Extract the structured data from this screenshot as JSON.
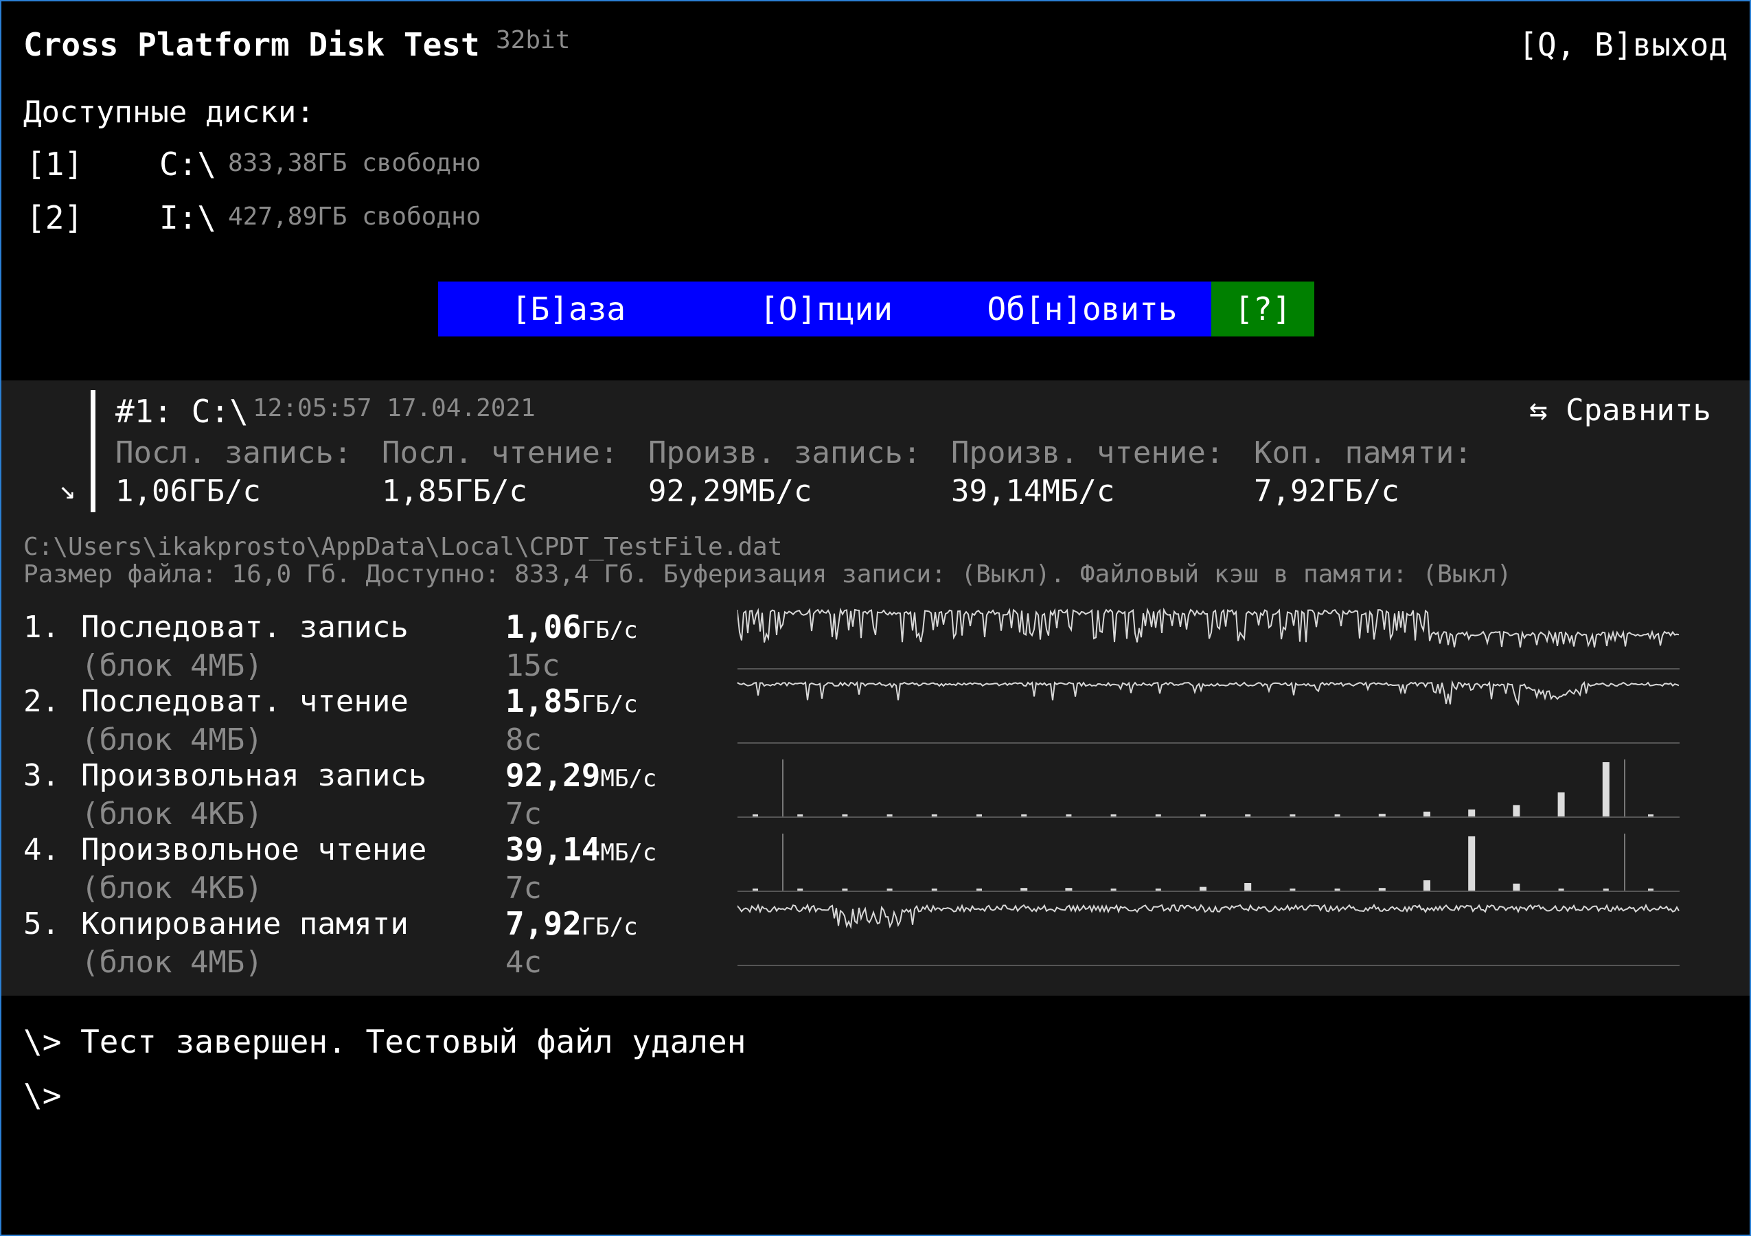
{
  "header": {
    "title": "Cross Platform Disk Test",
    "bits": "32bit",
    "exit": "[Q, B]выход"
  },
  "disks": {
    "label": "Доступные диски:",
    "items": [
      {
        "key": "[1]",
        "path": "C:\\",
        "free": "833,38ГБ свободно"
      },
      {
        "key": "[2]",
        "path": "I:\\",
        "free": "427,89ГБ свободно"
      }
    ]
  },
  "menu": {
    "base": "[Б]аза",
    "options": "[О]пции",
    "refresh": "Об[н]овить",
    "help": "[?]"
  },
  "summary": {
    "arrow": "↘",
    "title": "#1: C:\\",
    "datetime": "12:05:57 17.04.2021",
    "compare": "⇆ Сравнить",
    "cols": [
      {
        "label": "Посл. запись:",
        "value": "1,06ГБ/с"
      },
      {
        "label": "Посл. чтение:",
        "value": "1,85ГБ/с"
      },
      {
        "label": "Произв. запись:",
        "value": "92,29МБ/с"
      },
      {
        "label": "Произв. чтение:",
        "value": "39,14МБ/с"
      },
      {
        "label": "Коп. памяти:",
        "value": "7,92ГБ/с"
      }
    ]
  },
  "file": {
    "path": "C:\\Users\\ikakprosto\\AppData\\Local\\CPDT_TestFile.dat",
    "info": "Размер файла: 16,0 Гб. Доступно: 833,4 Гб. Буферизация записи: (Выкл). Файловый кэш в памяти: (Выкл)"
  },
  "tests": [
    {
      "idx": "1.",
      "name": "Последоват. запись",
      "block": "(блок 4МБ)",
      "value": "1,06",
      "unit": "ГБ/с",
      "time": "15с"
    },
    {
      "idx": "2.",
      "name": "Последоват. чтение",
      "block": "(блок 4МБ)",
      "value": "1,85",
      "unit": "ГБ/с",
      "time": "8с"
    },
    {
      "idx": "3.",
      "name": "Произвольная запись",
      "block": "(блок 4КБ)",
      "value": "92,29",
      "unit": "МБ/с",
      "time": "7с"
    },
    {
      "idx": "4.",
      "name": "Произвольное чтение",
      "block": "(блок 4КБ)",
      "value": "39,14",
      "unit": "МБ/с",
      "time": "7с"
    },
    {
      "idx": "5.",
      "name": "Копирование памяти",
      "block": "(блок 4МБ)",
      "value": "7,92",
      "unit": "ГБ/с",
      "time": "4с"
    }
  ],
  "histograms": {
    "random_write": [
      0.02,
      0.02,
      0.02,
      0.02,
      0.02,
      0.02,
      0.02,
      0.02,
      0.02,
      0.02,
      0.02,
      0.03,
      0.03,
      0.04,
      0.06,
      0.1,
      0.14,
      0.22,
      0.45,
      1.0,
      0.02
    ],
    "random_read": [
      0.02,
      0.02,
      0.02,
      0.02,
      0.02,
      0.02,
      0.06,
      0.06,
      0.02,
      0.02,
      0.08,
      0.15,
      0.04,
      0.04,
      0.06,
      0.2,
      1.0,
      0.14,
      0.03,
      0.05,
      0.02
    ]
  },
  "log": {
    "line1": "\\> Тест завершен. Тестовый файл удален",
    "line2": "\\>"
  },
  "colors": {
    "background": "#000000",
    "panel": "#1c1c1c",
    "menu_blue": "#0000ff",
    "help_green": "#008000",
    "muted_text": "#8a8a8a",
    "border": "#2a7fd4"
  }
}
